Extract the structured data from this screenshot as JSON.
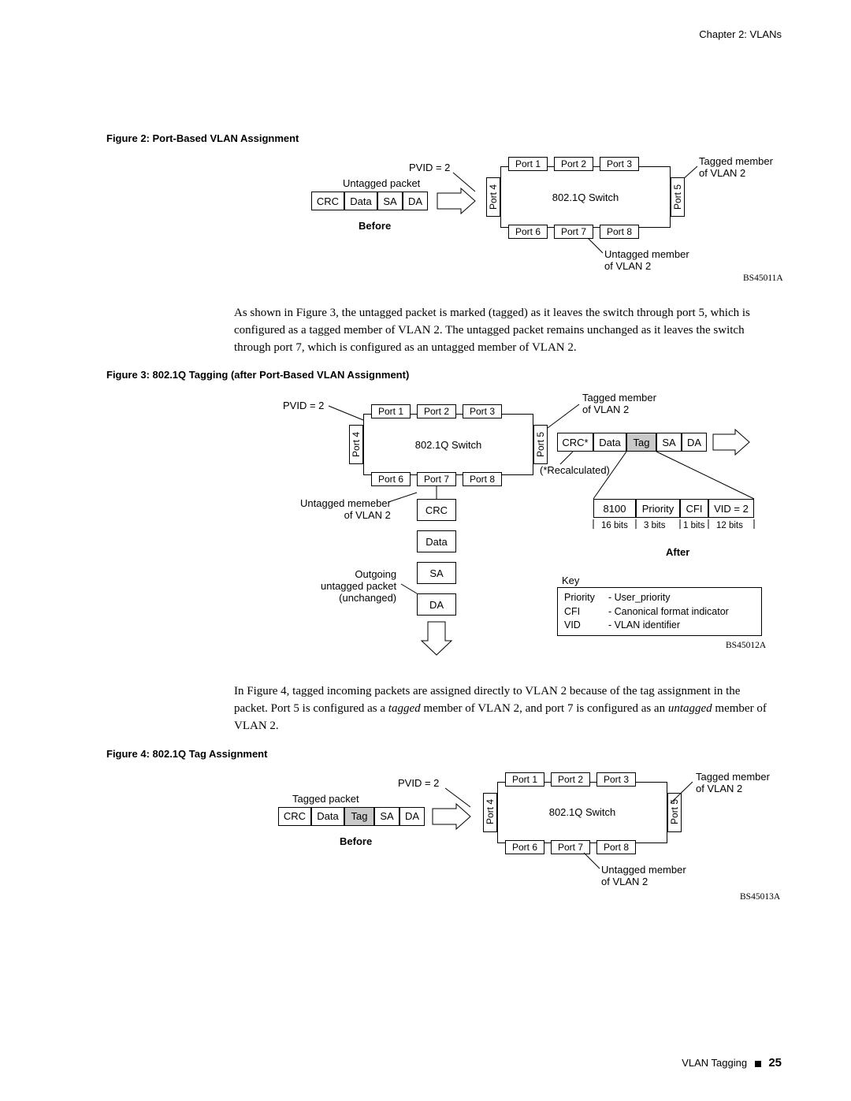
{
  "header": {
    "chapter": "Chapter 2: VLANs"
  },
  "fig2": {
    "caption": "Figure 2:  Port-Based VLAN Assignment",
    "pvid": "PVID = 2",
    "untagged_packet": "Untagged packet",
    "before": "Before",
    "packet": {
      "crc": "CRC",
      "data": "Data",
      "sa": "SA",
      "da": "DA"
    },
    "switch": "802.1Q Switch",
    "ports": {
      "p1": "Port 1",
      "p2": "Port 2",
      "p3": "Port 3",
      "p4": "Port 4",
      "p5": "Port 5",
      "p6": "Port 6",
      "p7": "Port 7",
      "p8": "Port 8"
    },
    "tagged_member_line1": "Tagged member",
    "tagged_member_line2": "of VLAN 2",
    "untagged_member_line1": "Untagged member",
    "untagged_member_line2": "of VLAN 2",
    "code": "BS45011A"
  },
  "para1": "As shown in Figure 3, the untagged packet is marked (tagged) as it leaves the switch through port 5, which is configured as a tagged member of VLAN 2. The untagged packet remains unchanged as it leaves the switch through port 7, which is configured as an untagged member of VLAN 2.",
  "fig3": {
    "caption": "Figure 3:  802.1Q Tagging (after Port-Based VLAN Assignment)",
    "pvid": "PVID = 2",
    "switch": "802.1Q Switch",
    "ports": {
      "p1": "Port 1",
      "p2": "Port 2",
      "p3": "Port 3",
      "p4": "Port 4",
      "p5": "Port 5",
      "p6": "Port 6",
      "p7": "Port 7",
      "p8": "Port 8"
    },
    "tagged_member_line1": "Tagged member",
    "tagged_member_line2": "of VLAN 2",
    "recalculated": "(*Recalculated)",
    "packet_out": {
      "crc": "CRC*",
      "data": "Data",
      "tag": "Tag",
      "sa": "SA",
      "da": "DA"
    },
    "untagged_memeber_line1": "Untagged memeber",
    "untagged_memeber_line2": "of VLAN 2",
    "outgoing_line1": "Outgoing",
    "outgoing_line2": "untagged packet",
    "outgoing_line3": "(unchanged)",
    "col_packet": {
      "crc": "CRC",
      "data": "Data",
      "sa": "SA",
      "da": "DA"
    },
    "tag_fields": {
      "f1": "8100",
      "f2": "Priority",
      "f3": "CFI",
      "f4": "VID = 2"
    },
    "tag_bits": {
      "b1": "16 bits",
      "b2": "3 bits",
      "b3": "1 bits",
      "b4": "12 bits"
    },
    "after": "After",
    "key_title": "Key",
    "key": {
      "priority_l": "Priority",
      "priority_r": "- User_priority",
      "cfi_l": "CFI",
      "cfi_r": "- Canonical format indicator",
      "vid_l": "VID",
      "vid_r": "- VLAN identifier"
    },
    "code": "BS45012A"
  },
  "para2_pre": "In Figure 4, tagged incoming packets are assigned directly to VLAN 2 because of the tag assignment in the packet. Port 5 is configured as a ",
  "para2_tagged": "tagged",
  "para2_mid": " member of VLAN 2, and port 7 is configured as an ",
  "para2_untagged": "untagged",
  "para2_post": " member of VLAN 2.",
  "fig4": {
    "caption": "Figure 4:  802.1Q Tag Assignment",
    "pvid": "PVID = 2",
    "tagged_packet": "Tagged packet",
    "before": "Before",
    "packet": {
      "crc": "CRC",
      "data": "Data",
      "tag": "Tag",
      "sa": "SA",
      "da": "DA"
    },
    "switch": "802.1Q Switch",
    "ports": {
      "p1": "Port 1",
      "p2": "Port 2",
      "p3": "Port 3",
      "p4": "Port 4",
      "p5": "Port 5",
      "p6": "Port 6",
      "p7": "Port 7",
      "p8": "Port 8"
    },
    "tagged_member_line1": "Tagged member",
    "tagged_member_line2": "of VLAN 2",
    "untagged_member_line1": "Untagged member",
    "untagged_member_line2": "of VLAN 2",
    "code": "BS45013A"
  },
  "footer": {
    "section": "VLAN Tagging",
    "page": "25"
  }
}
